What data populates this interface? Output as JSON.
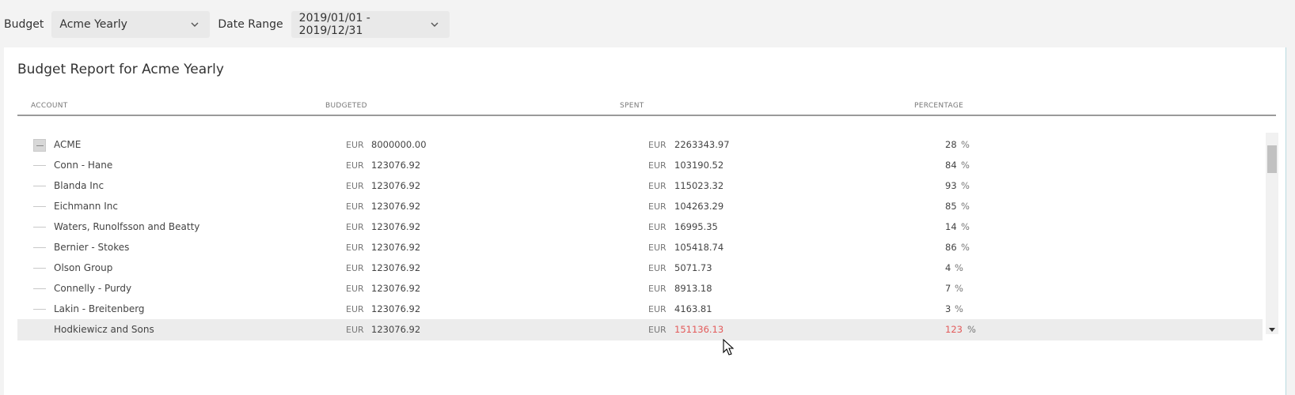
{
  "filters": {
    "budget_label": "Budget",
    "budget_value": "Acme Yearly",
    "range_label": "Date Range",
    "range_value": "2019/01/01 - 2019/12/31"
  },
  "report": {
    "title": "Budget Report for Acme Yearly",
    "columns": [
      "ACCOUNT",
      "BUDGETED",
      "SPENT",
      "PERCENTAGE"
    ],
    "currency": "EUR",
    "percent_unit": "%",
    "rows": [
      {
        "account": "ACME",
        "budgeted": "8000000.00",
        "spent": "2263343.97",
        "percentage": "28"
      },
      {
        "account": "Conn - Hane",
        "budgeted": "123076.92",
        "spent": "103190.52",
        "percentage": "84"
      },
      {
        "account": "Blanda Inc",
        "budgeted": "123076.92",
        "spent": "115023.32",
        "percentage": "93"
      },
      {
        "account": "Eichmann Inc",
        "budgeted": "123076.92",
        "spent": "104263.29",
        "percentage": "85"
      },
      {
        "account": "Waters, Runolfsson and Beatty",
        "budgeted": "123076.92",
        "spent": "16995.35",
        "percentage": "14"
      },
      {
        "account": "Bernier - Stokes",
        "budgeted": "123076.92",
        "spent": "105418.74",
        "percentage": "86"
      },
      {
        "account": "Olson Group",
        "budgeted": "123076.92",
        "spent": "5071.73",
        "percentage": "4"
      },
      {
        "account": "Connelly - Purdy",
        "budgeted": "123076.92",
        "spent": "8913.18",
        "percentage": "7"
      },
      {
        "account": "Lakin - Breitenberg",
        "budgeted": "123076.92",
        "spent": "4163.81",
        "percentage": "3"
      },
      {
        "account": "Hodkiewicz and Sons",
        "budgeted": "123076.92",
        "spent": "151136.13",
        "percentage": "123"
      }
    ]
  },
  "colors": {
    "over_budget": "#e35a5a",
    "selected_row": "#ececec"
  }
}
